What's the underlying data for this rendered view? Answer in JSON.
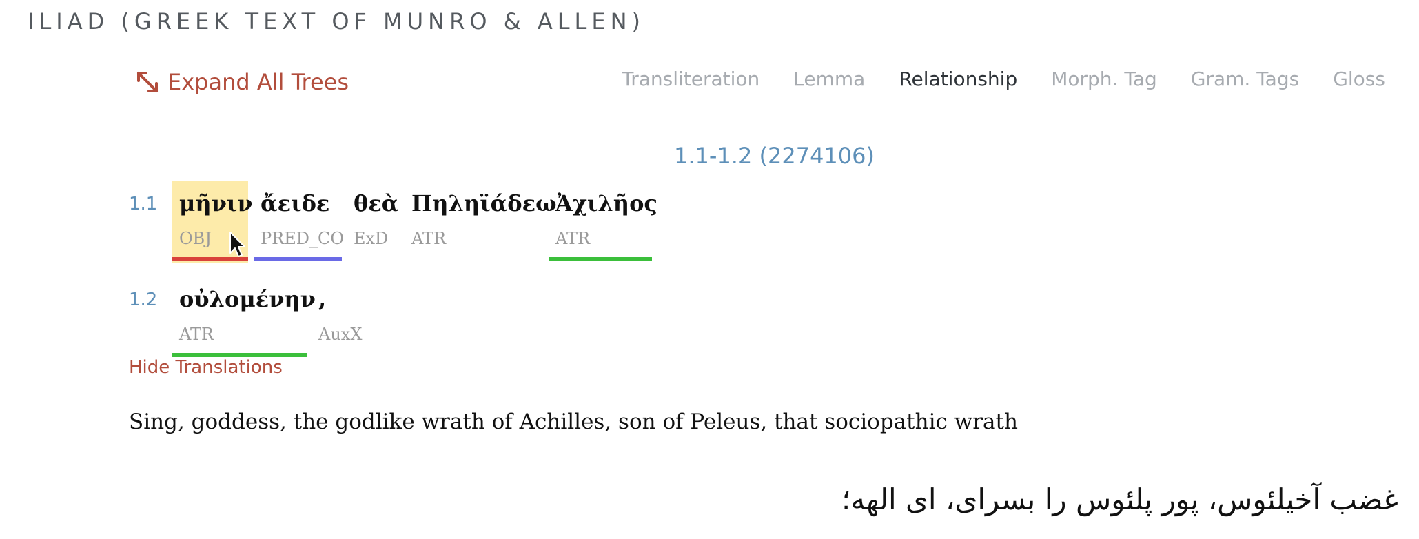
{
  "header": {
    "title": "ILIAD (GREEK TEXT OF MUNRO & ALLEN)"
  },
  "toolbar": {
    "expand_label": "Expand All Trees",
    "expand_icon": "expand-arrows-icon",
    "tabs": [
      {
        "label": "Transliteration",
        "active": false
      },
      {
        "label": "Lemma",
        "active": false
      },
      {
        "label": "Relationship",
        "active": true
      },
      {
        "label": "Morph. Tag",
        "active": false
      },
      {
        "label": "Gram. Tags",
        "active": false
      },
      {
        "label": "Gloss",
        "active": false
      }
    ]
  },
  "passage": {
    "reference": "1.1-1.2 (2274106)",
    "lines": [
      {
        "number": "1.1",
        "words": [
          {
            "greek": "μῆνιν",
            "rel": "OBJ",
            "highlighted": true,
            "bar_color": "#d9423a"
          },
          {
            "greek": "ἄειδε",
            "rel": "PRED_CO",
            "bar_color": "#6a6ae6"
          },
          {
            "greek": "θεὰ",
            "rel": "ExD",
            "bar_color": ""
          },
          {
            "greek": "Πηληϊάδεω",
            "rel": "ATR",
            "bar_color": ""
          },
          {
            "greek": "Ἀχιλῆος",
            "rel": "ATR",
            "bar_color": "#3bbf3b"
          }
        ]
      },
      {
        "number": "1.2",
        "words": [
          {
            "greek": "οὐλομένην",
            "rel": "ATR",
            "bar_color": "#3bbf3b"
          },
          {
            "greek": ",",
            "rel": "AuxX",
            "bar_color": ""
          }
        ]
      }
    ],
    "hide_translations_label": "Hide Translations",
    "translation_en": "Sing, goddess, the godlike wrath of Achilles, son of Peleus, that sociopathic wrath",
    "translation_fa": "غضب آخیلئوس، پور پلئوس را بسرای، ای الهه؛"
  },
  "colors": {
    "accent_red": "#b24d3c",
    "link_blue": "#5d8fb8",
    "highlight": "#fdebaa"
  }
}
